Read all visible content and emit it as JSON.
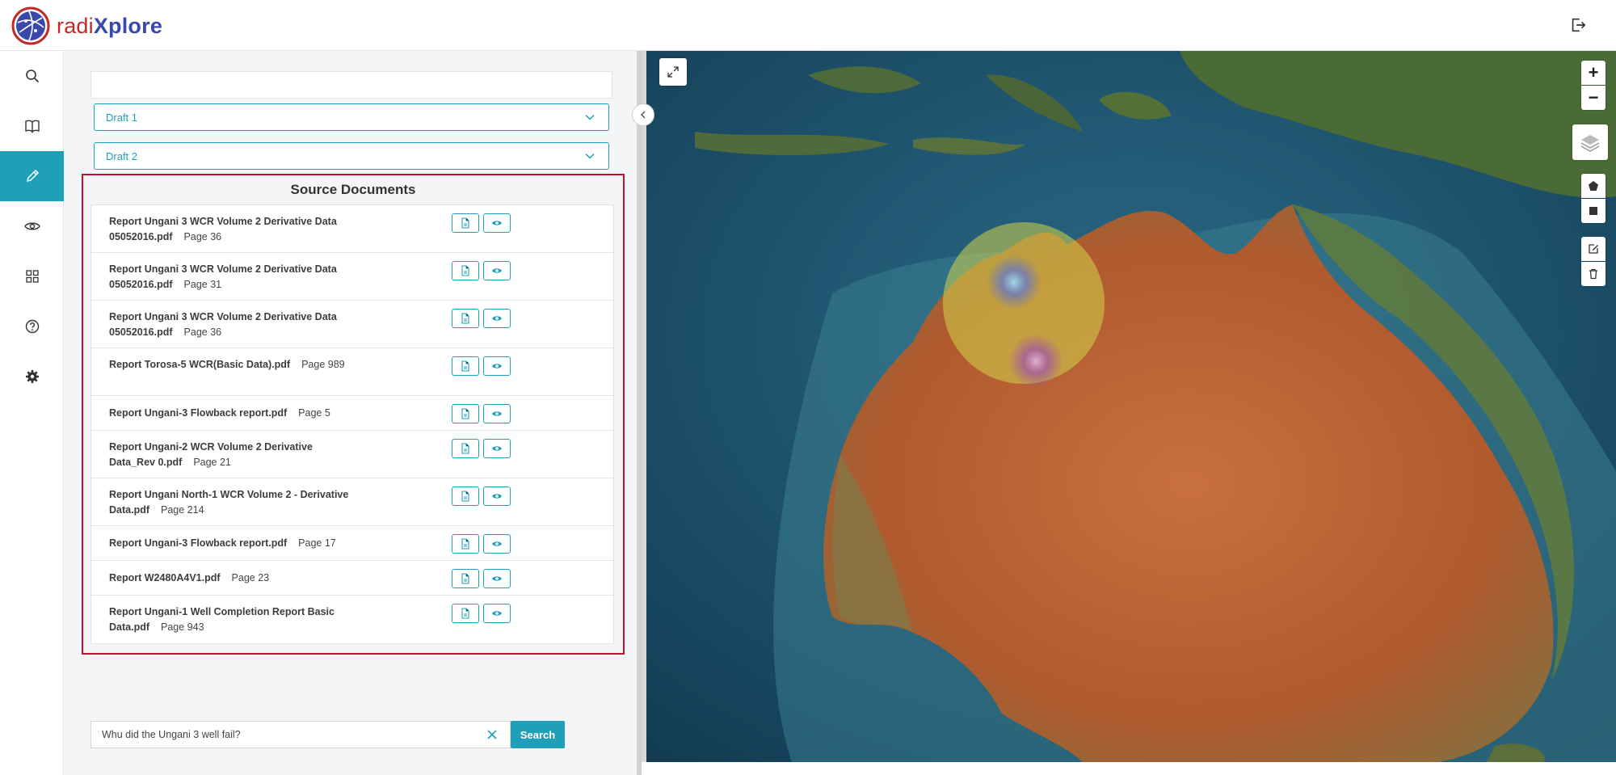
{
  "app": {
    "logo_part1": "radi",
    "logo_part2": "Xplore"
  },
  "nav": {
    "items": [
      {
        "icon": "search-icon"
      },
      {
        "icon": "book-icon"
      },
      {
        "icon": "pencil-icon",
        "active": true
      },
      {
        "icon": "eye-icon"
      },
      {
        "icon": "grid-icon"
      },
      {
        "icon": "help-icon"
      },
      {
        "icon": "gear-icon"
      }
    ]
  },
  "drafts": [
    {
      "label": "Draft 1"
    },
    {
      "label": "Draft 2"
    }
  ],
  "sources": {
    "title": "Source Documents",
    "documents": [
      {
        "name": "Report Ungani 3 WCR Volume 2 Derivative Data 05052016.pdf",
        "page": "Page 36"
      },
      {
        "name": "Report Ungani 3 WCR Volume 2 Derivative Data 05052016.pdf",
        "page": "Page 31"
      },
      {
        "name": "Report Ungani 3 WCR Volume 2 Derivative Data 05052016.pdf",
        "page": "Page 36"
      },
      {
        "name": "Report Torosa-5 WCR(Basic Data).pdf",
        "page": "Page 989"
      },
      {
        "name": "Report Ungani-3 Flowback report.pdf",
        "page": "Page 5"
      },
      {
        "name": "Report Ungani-2 WCR Volume 2 Derivative Data_Rev 0.pdf",
        "page": "Page 21"
      },
      {
        "name": "Report Ungani North-1 WCR Volume 2 - Derivative Data.pdf",
        "page": "Page 214"
      },
      {
        "name": "Report Ungani-3 Flowback report.pdf",
        "page": "Page 17"
      },
      {
        "name": "Report W2480A4V1.pdf",
        "page": "Page 23"
      },
      {
        "name": "Report Ungani-1 Well Completion Report Basic Data.pdf",
        "page": "Page 943"
      }
    ]
  },
  "search": {
    "value": "Whu did the Ungani 3 well fail?",
    "button_label": "Search"
  },
  "map": {
    "zoom_in": "+",
    "zoom_out": "−"
  },
  "colors": {
    "accent": "#1f9fb8",
    "highlight_border": "#c8102e"
  }
}
